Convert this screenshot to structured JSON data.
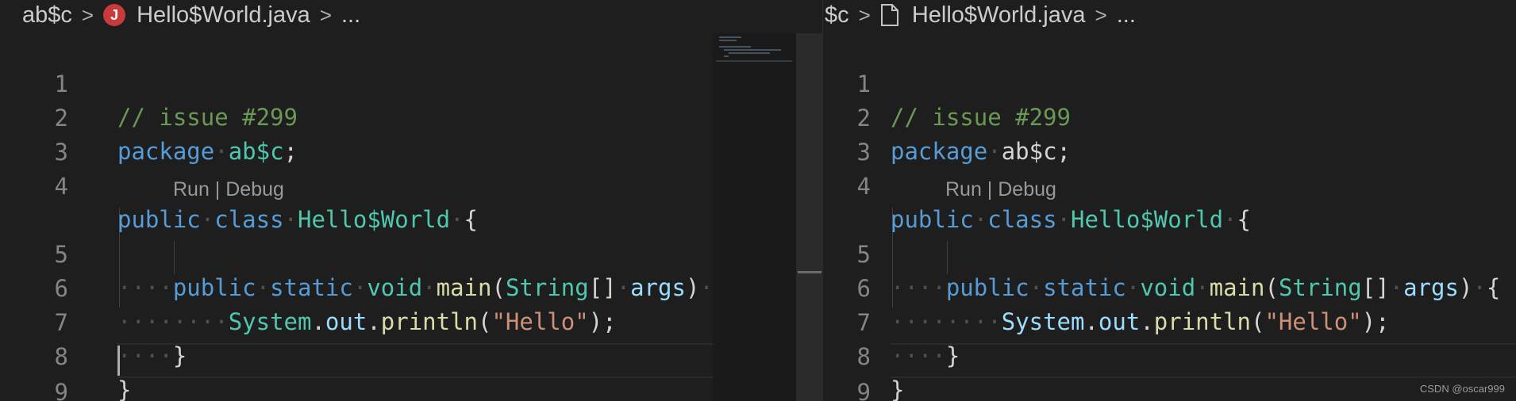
{
  "left_editor": {
    "breadcrumb": {
      "folder": "ab$c",
      "file": "Hello$World.java",
      "more": "...",
      "separator": ">",
      "file_icon_letter": "J"
    },
    "codelens": "Run | Debug",
    "line_numbers": [
      "1",
      "2",
      "3",
      "4",
      "5",
      "6",
      "7",
      "8",
      "9"
    ],
    "lines": {
      "l1": "// issue #299",
      "l2": {
        "kw": "package",
        "ws1": "·",
        "name": "ab$c",
        "semi": ";"
      },
      "l4": {
        "kw1": "public",
        "ws1": "·",
        "kw2": "class",
        "ws2": "·",
        "cls": "Hello$World",
        "ws3": "·",
        "brace": "{"
      },
      "l5": {
        "indent": "····",
        "kw1": "public",
        "ws1": "·",
        "kw2": "static",
        "ws2": "·",
        "kw3": "void",
        "ws3": "·",
        "fn": "main",
        "p1": "(",
        "ty": "String",
        "arr": "[]",
        "ws4": "·",
        "arg": "args",
        "p2": ")",
        "trail": "·"
      },
      "l6": {
        "indent": "····",
        "indent2": "····",
        "cls": "System",
        "dot1": ".",
        "field": "out",
        "dot2": ".",
        "fn": "println",
        "p1": "(",
        "str": "\"Hello\"",
        "p2": ");"
      },
      "l7": {
        "indent": "····",
        "brace": "}"
      },
      "l8": {
        "brace": "}"
      }
    }
  },
  "right_editor": {
    "breadcrumb": {
      "folder": "$c",
      "file": "Hello$World.java",
      "more": "...",
      "separator": ">"
    },
    "codelens": "Run | Debug",
    "line_numbers": [
      "1",
      "2",
      "3",
      "4",
      "5",
      "6",
      "7",
      "8",
      "9"
    ],
    "lines": {
      "l1": "// issue #299",
      "l2": {
        "kw": "package",
        "ws1": "·",
        "name": "ab$c",
        "semi": ";"
      },
      "l4": {
        "kw1": "public",
        "ws1": "·",
        "kw2": "class",
        "ws2": "·",
        "cls": "Hello$World",
        "ws3": "·",
        "brace": "{"
      },
      "l5": {
        "indent": "····",
        "kw1": "public",
        "ws1": "·",
        "kw2": "static",
        "ws2": "·",
        "kw3": "void",
        "ws3": "·",
        "fn": "main",
        "p1": "(",
        "ty": "String",
        "arr": "[]",
        "ws4": "·",
        "arg": "args",
        "p2": ")",
        "ws5": "·",
        "brace": "{"
      },
      "l6": {
        "indent": "····",
        "indent2": "····",
        "cls": "System",
        "dot1": ".",
        "field": "out",
        "dot2": ".",
        "fn": "println",
        "p1": "(",
        "str": "\"Hello\"",
        "p2": ");"
      },
      "l7": {
        "indent": "····",
        "brace": "}"
      },
      "l8": {
        "brace": "}"
      }
    }
  },
  "watermark": "CSDN @oscar999",
  "colors": {
    "keyword": "#569cd6",
    "type": "#4ec9b0",
    "function": "#dcdcaa",
    "string": "#ce9178",
    "comment": "#6a9955",
    "variable": "#9cdcfe",
    "background": "#1e1e1e",
    "error_icon": "#c93b3b"
  }
}
